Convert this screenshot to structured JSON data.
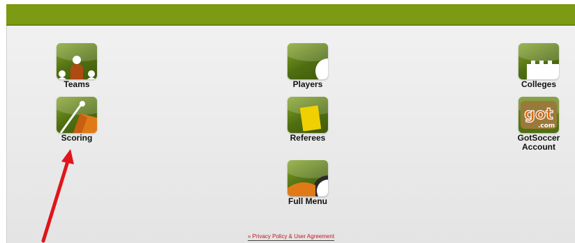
{
  "tiles": {
    "teams": {
      "label": "Teams",
      "icon": "team-people-icon"
    },
    "players": {
      "label": "Players",
      "icon": "ball-icon"
    },
    "colleges": {
      "label": "Colleges",
      "icon": "castle-icon"
    },
    "scoring": {
      "label": "Scoring",
      "icon": "corner-flag-icon"
    },
    "referees": {
      "label": "Referees",
      "icon": "yellow-card-icon"
    },
    "gotsoccer": {
      "label_line1": "GotSoccer",
      "label_line2": "Account",
      "logo_text": "got",
      "logo_sub": ".com",
      "icon": "gotsoccer-logo-icon"
    },
    "fullmenu": {
      "label": "Full Menu",
      "icon": "soccer-ball-icon"
    }
  },
  "footer": {
    "privacy_link": "» Privacy Policy & User Agreement"
  },
  "colors": {
    "topbar": "#7c9a12",
    "icon_green": "#4f6e11",
    "link_red": "#c01818",
    "annotation_arrow": "#e0141a"
  }
}
